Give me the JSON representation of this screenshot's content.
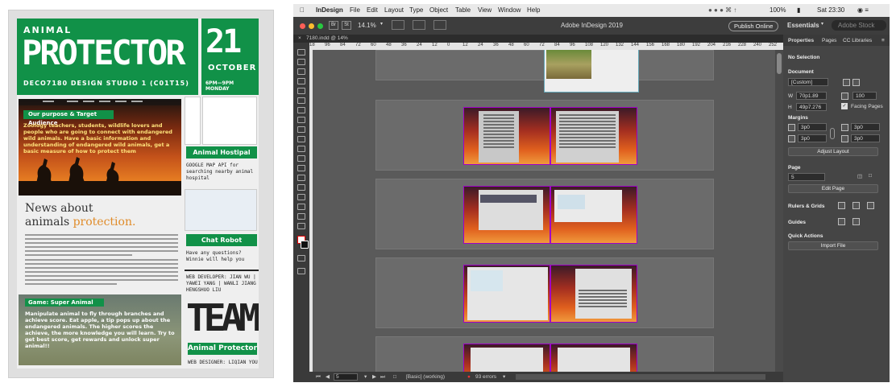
{
  "poster": {
    "animal": "ANIMAL",
    "protector": "PROTECTOR",
    "course": "DECO7180 DESIGN STUDIO 1 (C01T15)",
    "day": "21",
    "month": "OCTOBER",
    "time": "6PM—9PM MONDAY",
    "purpose_title": "Our purpose & Target Audience",
    "purpose_text": "Zoology teachers, students, wildlife lovers and people who are going to connect with endangered wild animals. Have a basic information and understanding of endangered wild animals, get a basic measure of how to protect them",
    "hospital_title": "Animal Hostipal Search",
    "hospital_text": "GOOGLE MAP API for searching nearby animal hospital",
    "news_line1": "News about",
    "news_line2": "animals",
    "news_highlight": "protection.",
    "chat_title": "Chat Robot",
    "chat_text": "Have any questions? Winnie will help you",
    "dev": "WEB DEVELOPER: JIAN WU | YAWEI YANG | WANLI JIANG HENGSHUO LIU",
    "game_title": "Game: Super Animal",
    "game_text": "Manipulate animal to fly through branches and achieve score. Eat apple, a tip pops up about the endangered animals. The higher scores the achieve, the more knowledge you will learn. Try to get best score, get rewards and unlock super animal!!",
    "team": "TEAM",
    "team_label": "Animal Protector",
    "designer": "WEB DESIGNER: LIQIAN YOU"
  },
  "menubar": {
    "app": "InDesign",
    "items": [
      "File",
      "Edit",
      "Layout",
      "Type",
      "Object",
      "Table",
      "View",
      "Window",
      "Help"
    ],
    "battery": "100%",
    "clock": "Sat 23:30"
  },
  "titlebar": {
    "zoom": "14.1%",
    "title": "Adobe InDesign 2019",
    "publish": "Publish Online",
    "workspace": "Essentials",
    "search": "Adobe Stock"
  },
  "tab": {
    "label": "7180.indd @ 14%"
  },
  "ruler_ticks": [
    "18",
    "96",
    "84",
    "72",
    "60",
    "48",
    "36",
    "24",
    "12",
    "0",
    "12",
    "24",
    "36",
    "48",
    "60",
    "72",
    "84",
    "96",
    "108",
    "120",
    "132",
    "144",
    "156",
    "168",
    "180",
    "192",
    "204",
    "216",
    "228",
    "240",
    "252"
  ],
  "panel": {
    "tabs": [
      "Properties",
      "Pages",
      "CC Libraries"
    ],
    "no_selection": "No Selection",
    "document": "Document",
    "preset": "[Custom]",
    "w_label": "W",
    "w_value": "70p1.89",
    "h_label": "H",
    "h_value": "49p7.276",
    "pages_count": "100",
    "facing_pages": "Facing Pages",
    "margins": "Margins",
    "margin_values": [
      "3p0",
      "3p0",
      "3p0",
      "3p0"
    ],
    "adjust_layout": "Adjust Layout",
    "page_label": "Page",
    "page_value": "5",
    "edit_page": "Edit Page",
    "rulers_grids": "Rulers & Grids",
    "guides": "Guides",
    "quick_actions": "Quick Actions",
    "import_file": "Import File"
  },
  "status": {
    "page": "5",
    "style": "[Basic] (working)",
    "errors": "93 errors"
  }
}
